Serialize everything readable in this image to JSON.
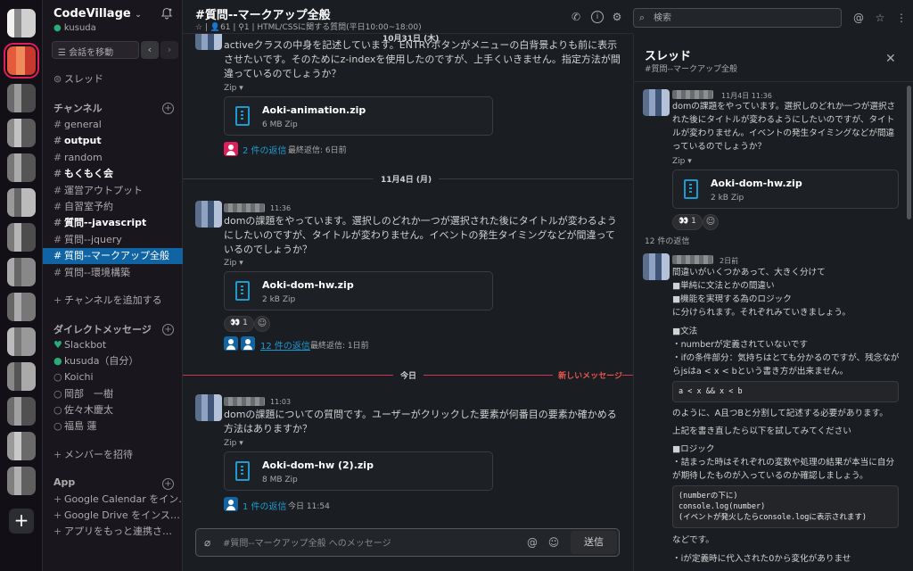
{
  "workspace": {
    "name": "CodeVillage",
    "user": "kusuda",
    "jump_label": "会話を移動"
  },
  "sidebar": {
    "threads_label": "スレッド",
    "channels_header": "チャンネル",
    "channels": [
      {
        "name": "general",
        "bold": false,
        "active": false
      },
      {
        "name": "output",
        "bold": true,
        "active": false
      },
      {
        "name": "random",
        "bold": false,
        "active": false
      },
      {
        "name": "もくもく会",
        "bold": true,
        "active": false
      },
      {
        "name": "運営アウトプット",
        "bold": false,
        "active": false
      },
      {
        "name": "自習室予約",
        "bold": false,
        "active": false
      },
      {
        "name": "質問--javascript",
        "bold": true,
        "active": false
      },
      {
        "name": "質問--jquery",
        "bold": false,
        "active": false
      },
      {
        "name": "質問--マークアップ全般",
        "bold": false,
        "active": true
      },
      {
        "name": "質問--環境構築",
        "bold": false,
        "active": false
      }
    ],
    "add_channel": "チャンネルを追加する",
    "dm_header": "ダイレクトメッセージ",
    "dms": [
      {
        "name": "Slackbot",
        "prefix": "♥"
      },
      {
        "name": "kusuda（自分）",
        "prefix": "●"
      },
      {
        "name": "Koichi",
        "prefix": "○"
      },
      {
        "name": "岡部　一樹",
        "prefix": "○"
      },
      {
        "name": "佐々木慶太",
        "prefix": "○"
      },
      {
        "name": "福島 蓮",
        "prefix": "○"
      }
    ],
    "invite": "メンバーを招待",
    "app_header": "App",
    "apps": [
      "Google Calendar をイン…",
      "Google Drive をインス…",
      "アプリをもっと連携さ…"
    ]
  },
  "channel": {
    "title": "#質問--マークアップ全般",
    "members": "61",
    "pins": "1",
    "topic": "HTML/CSSに関する質問(平日10:00~18:00)",
    "date_oct31": "10月31日 (木)",
    "date_nov4": "11月4日 (月)",
    "date_today": "今日",
    "new_messages": "新しいメッセージ",
    "messages": [
      {
        "text": "activeクラスの中身を記述しています。ENTRYボタンがメニューの白背景よりも前に表示させたいです。そのためにz-indexを使用したのですが、上手くいきません。指定方法が間違っているのでしょうか？",
        "zip_label": "Zip ▾",
        "file": {
          "name": "Aoki-animation.zip",
          "meta": "6 MB Zip"
        },
        "replies": "2 件の返信",
        "last_reply": "最終返信: 6日前"
      },
      {
        "time": "11:36",
        "text": "domの課題をやっています。選択しのどれか一つが選択された後にタイトルが変わるようにしたいのですが、タイトルが変わりません。イベントの発生タイミングなどが間違っているのでしょうか？",
        "zip_label": "Zip ▾",
        "file": {
          "name": "Aoki-dom-hw.zip",
          "meta": "2 kB Zip"
        },
        "reaction": "👀 1",
        "replies": "12 件の返信",
        "last_reply": "最終返信: 1日前"
      },
      {
        "time": "11:03",
        "text": "domの課題についての質問です。ユーザーがクリックした要素が何番目の要素か確かめる方法はありますか？",
        "zip_label": "Zip ▾",
        "file": {
          "name": "Aoki-dom-hw (2).zip",
          "meta": "8 MB Zip"
        },
        "replies": "1 件の返信",
        "last_reply": "今日 11:54"
      }
    ],
    "composer_placeholder": "#質問--マークアップ全般 へのメッセージ",
    "send": "送信"
  },
  "search": {
    "placeholder": "検索"
  },
  "thread": {
    "title": "スレッド",
    "subtitle": "#質問--マークアップ全般",
    "parent": {
      "time": "11月4日 11:36",
      "text": "domの課題をやっています。選択しのどれか一つが選択された後にタイトルが変わるようにしたいのですが、タイトルが変わりません。イベントの発生タイミングなどが間違っているのでしょうか？",
      "zip_label": "Zip ▾",
      "file": {
        "name": "Aoki-dom-hw.zip",
        "meta": "2 kB Zip"
      },
      "reaction": "👀 1"
    },
    "reply_count": "12 件の返信",
    "reply": {
      "time": "2日前",
      "lines": [
        "間違いがいくつかあって、大きく分けて",
        "■単純に文法とかの間違い",
        "■機能を実現する為のロジック",
        "に分けられます。それぞれみていきましょう。"
      ],
      "grammar_head": "■文法",
      "grammar_lines": [
        "・numberが定義されていないです",
        "・ifの条件部分：気持ちはとても分かるのですが、残念ながらjsはa < x < bという書き方が出来ません。"
      ],
      "code1": "a < x && x < b",
      "after_code1": "のように、A且つBと分割して記述する必要があります。",
      "try_text": "上記を書き直したら以下を試してみてください",
      "logic_head": "■ロジック",
      "logic_text": "・詰まった時はそれぞれの変数や処理の結果が本当に自分が期待したものが入っているのか確認しましょう。",
      "code2": "(numberの下に)\nconsole.log(number)\n(イベントが発火したらconsole.logに表示されます)",
      "etc": "などです。",
      "last_line": "・iが定義時に代入された0から変化がありませ"
    }
  }
}
